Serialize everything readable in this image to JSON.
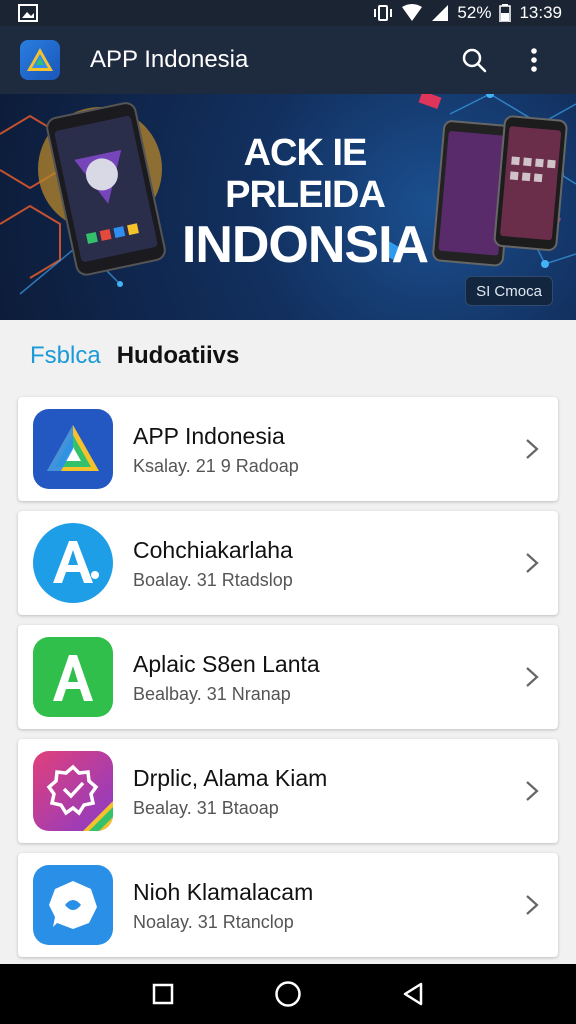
{
  "status_bar": {
    "battery": "52%",
    "time": "13:39"
  },
  "app_bar": {
    "title": "APP Indonesia",
    "icons": [
      "search-icon",
      "more-vert-icon"
    ]
  },
  "banner": {
    "line1": "ACK IE PRLEIDA",
    "line2": "INDONSIA",
    "chip_label": "SI Cmoca"
  },
  "section": {
    "accent": "Fsblca",
    "title": "Hudoatiivs"
  },
  "apps": [
    {
      "name": "APP Indonesia",
      "meta": "Ksalay. 21 9 Radoap",
      "icon": "triangle-logo-icon",
      "color": "#2357c2"
    },
    {
      "name": "Cohchiakarlaha",
      "meta": "Boalay. 31 Rtadslop",
      "icon": "letter-a-icon",
      "color": "#1e9ee6"
    },
    {
      "name": "Aplaic S8en Lanta",
      "meta": "Bealbay. 31 Nranap",
      "icon": "letter-a-icon",
      "color": "#2fbf4a"
    },
    {
      "name": "Drplic, Alama Kiam",
      "meta": "Bealay. 31 Btaoap",
      "icon": "badge-check-icon",
      "color": "#b5379f"
    },
    {
      "name": "Nioh Klamalacam",
      "meta": "Noalay. 31 Rtanclop",
      "icon": "chat-bubble-icon",
      "color": "#2a8fe6"
    }
  ],
  "nav_bar": {
    "icons": [
      "recents-square-icon",
      "home-circle-icon",
      "back-triangle-icon"
    ]
  }
}
